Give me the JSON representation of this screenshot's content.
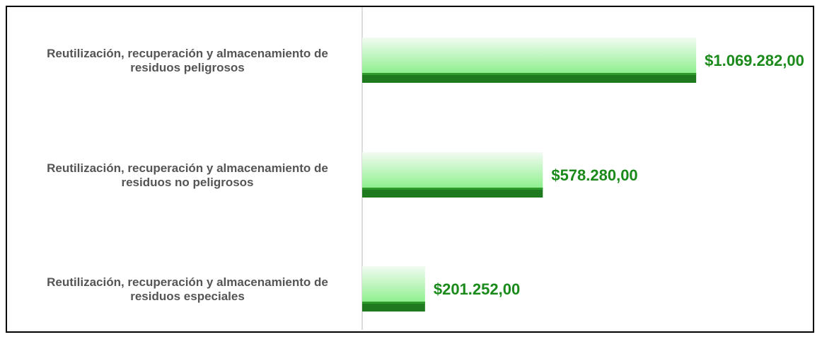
{
  "chart_data": {
    "type": "bar",
    "orientation": "horizontal",
    "categories": [
      [
        "Reutilización, recuperación y almacenamiento de",
        "residuos peligrosos"
      ],
      [
        "Reutilización, recuperación y almacenamiento de",
        "residuos no peligrosos"
      ],
      [
        "Reutilización, recuperación y almacenamiento de",
        "residuos especiales"
      ]
    ],
    "values": [
      1069282.0,
      578280.0,
      201252.0
    ],
    "value_labels": [
      "$1.069.282,00",
      "$578.280,00",
      "$201.252,00"
    ],
    "title": "",
    "xlabel": "",
    "ylabel": "",
    "xlim": [
      0,
      1300000
    ],
    "grid": false,
    "legend": "none"
  },
  "colors": {
    "bar_top": "#f2fbf2",
    "bar_mid": "#8ff08f",
    "bar_base": "#1f7a1f",
    "value_label": "#1a8a1a",
    "axis_line": "#d0d0d0",
    "category_label": "#555555",
    "frame": "#000000"
  }
}
